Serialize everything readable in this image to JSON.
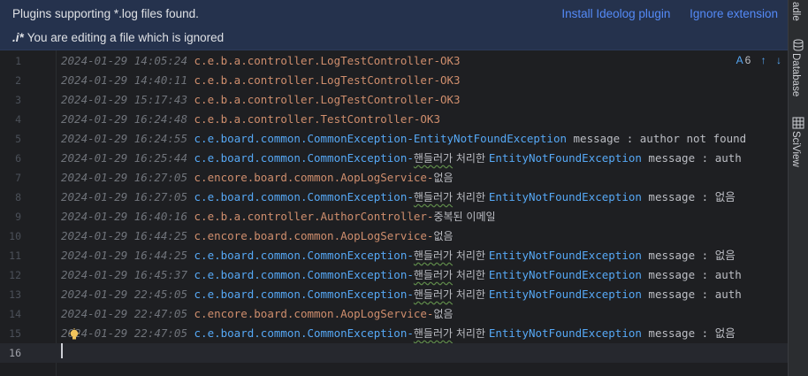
{
  "banner": {
    "message": "Plugins supporting *.log files found.",
    "install_link": "Install Ideolog plugin",
    "ignore_link": "Ignore extension",
    "ignored_prefix": ".i*",
    "ignored_text": "You are editing a file which is ignored"
  },
  "right_strip": {
    "top_label": "adle",
    "database_label": "Database",
    "sciview_label": "SciView"
  },
  "toolbar": {
    "inspection_count": "6",
    "inspection_icon": "A",
    "up_icon": "↑",
    "down_icon": "↓"
  },
  "lines": [
    {
      "n": "1",
      "ts": "2024-01-29 14:05:24",
      "parts": [
        {
          "t": "c.e.b.a.controller.LogTestController-OK3",
          "c": "pkg"
        }
      ]
    },
    {
      "n": "2",
      "ts": "2024-01-29 14:40:11",
      "parts": [
        {
          "t": "c.e.b.a.controller.LogTestController-OK3",
          "c": "pkg"
        }
      ]
    },
    {
      "n": "3",
      "ts": "2024-01-29 15:17:43",
      "parts": [
        {
          "t": "c.e.b.a.controller.LogTestController-OK3",
          "c": "pkg"
        }
      ]
    },
    {
      "n": "4",
      "ts": "2024-01-29 16:24:48",
      "parts": [
        {
          "t": "c.e.b.a.controller.TestController-OK3",
          "c": "pkg"
        }
      ]
    },
    {
      "n": "5",
      "ts": "2024-01-29 16:24:55",
      "parts": [
        {
          "t": "c.e.",
          "c": "cls"
        },
        {
          "t": "board",
          "c": "cls"
        },
        {
          "t": ".common.CommonException-",
          "c": "cls"
        },
        {
          "t": "EntityNotFoundException",
          "c": "cls"
        },
        {
          "t": " message : author not found",
          "c": "msg"
        }
      ]
    },
    {
      "n": "6",
      "ts": "2024-01-29 16:25:44",
      "parts": [
        {
          "t": "c.e.board.common.CommonException-",
          "c": "cls"
        },
        {
          "t": "핸들러가",
          "c": "kor wavy"
        },
        {
          "t": " 처리한 ",
          "c": "kor"
        },
        {
          "t": "EntityNotFoundException",
          "c": "cls"
        },
        {
          "t": " message : auth",
          "c": "msg"
        }
      ]
    },
    {
      "n": "7",
      "ts": "2024-01-29 16:27:05",
      "parts": [
        {
          "t": "c.encore.board.common.AopLogService-",
          "c": "pkg"
        },
        {
          "t": "없음",
          "c": "kor"
        }
      ]
    },
    {
      "n": "8",
      "ts": "2024-01-29 16:27:05",
      "parts": [
        {
          "t": "c.e.board.common.CommonException-",
          "c": "cls"
        },
        {
          "t": "핸들러가",
          "c": "kor wavy"
        },
        {
          "t": " 처리한 ",
          "c": "kor"
        },
        {
          "t": "EntityNotFoundException",
          "c": "cls"
        },
        {
          "t": " message : 없음",
          "c": "msg"
        }
      ]
    },
    {
      "n": "9",
      "ts": "2024-01-29 16:40:16",
      "parts": [
        {
          "t": "c.e.b.a.controller.AuthorController-",
          "c": "pkg"
        },
        {
          "t": "중복된 이메일",
          "c": "kor"
        }
      ]
    },
    {
      "n": "10",
      "ts": "2024-01-29 16:44:25",
      "parts": [
        {
          "t": "c.encore.board.common.AopLogService-",
          "c": "pkg"
        },
        {
          "t": "없음",
          "c": "kor"
        }
      ]
    },
    {
      "n": "11",
      "ts": "2024-01-29 16:44:25",
      "parts": [
        {
          "t": "c.e.board.common.CommonException-",
          "c": "cls"
        },
        {
          "t": "핸들러가",
          "c": "kor wavy"
        },
        {
          "t": " 처리한 ",
          "c": "kor"
        },
        {
          "t": "EntityNotFoundException",
          "c": "cls"
        },
        {
          "t": " message : 없음",
          "c": "msg"
        }
      ]
    },
    {
      "n": "12",
      "ts": "2024-01-29 16:45:37",
      "parts": [
        {
          "t": "c.e.board.common.CommonException-",
          "c": "cls"
        },
        {
          "t": "핸들러가",
          "c": "kor wavy"
        },
        {
          "t": " 처리한 ",
          "c": "kor"
        },
        {
          "t": "EntityNotFoundException",
          "c": "cls"
        },
        {
          "t": " message : auth",
          "c": "msg"
        }
      ]
    },
    {
      "n": "13",
      "ts": "2024-01-29 22:45:05",
      "parts": [
        {
          "t": "c.e.board.common.CommonException-",
          "c": "cls"
        },
        {
          "t": "핸들러가",
          "c": "kor wavy"
        },
        {
          "t": " 처리한 ",
          "c": "kor"
        },
        {
          "t": "EntityNotFoundException",
          "c": "cls"
        },
        {
          "t": " message : auth",
          "c": "msg"
        }
      ]
    },
    {
      "n": "14",
      "ts": "2024-01-29 22:47:05",
      "parts": [
        {
          "t": "c.encore.board.common.AopLogService-",
          "c": "pkg"
        },
        {
          "t": "없음",
          "c": "kor"
        }
      ]
    },
    {
      "n": "15",
      "ts": "2024-01-29 22:47:05",
      "parts": [
        {
          "t": "c.e.board.common.CommonException-",
          "c": "cls"
        },
        {
          "t": "핸들러가",
          "c": "kor wavy"
        },
        {
          "t": " 처리한 ",
          "c": "kor"
        },
        {
          "t": "EntityNotFoundException",
          "c": "cls"
        },
        {
          "t": " message : 없음",
          "c": "msg"
        }
      ]
    },
    {
      "n": "16",
      "ts": "",
      "parts": []
    }
  ]
}
